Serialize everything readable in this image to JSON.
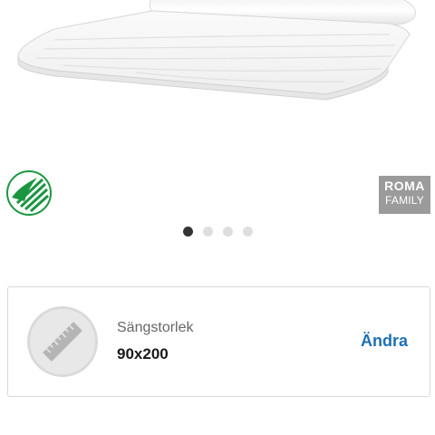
{
  "product": {
    "image_icon": "mattress-topper-image"
  },
  "badges": {
    "ecolabel_icon": "nordic-swan-ecolabel-icon",
    "brand_line1": "ROMA",
    "brand_line2": "FAMILY",
    "brand_bg": "#9b9b9b"
  },
  "carousel": {
    "count": 4,
    "active_index": 0,
    "active_color": "#333333",
    "inactive_color": "#dedede"
  },
  "size_selector": {
    "icon": "ruler-icon",
    "label": "Sängstorlek",
    "value": "90x200",
    "change_label": "Ändra",
    "link_color": "#1d6fb3"
  },
  "description": {
    "text": ""
  }
}
